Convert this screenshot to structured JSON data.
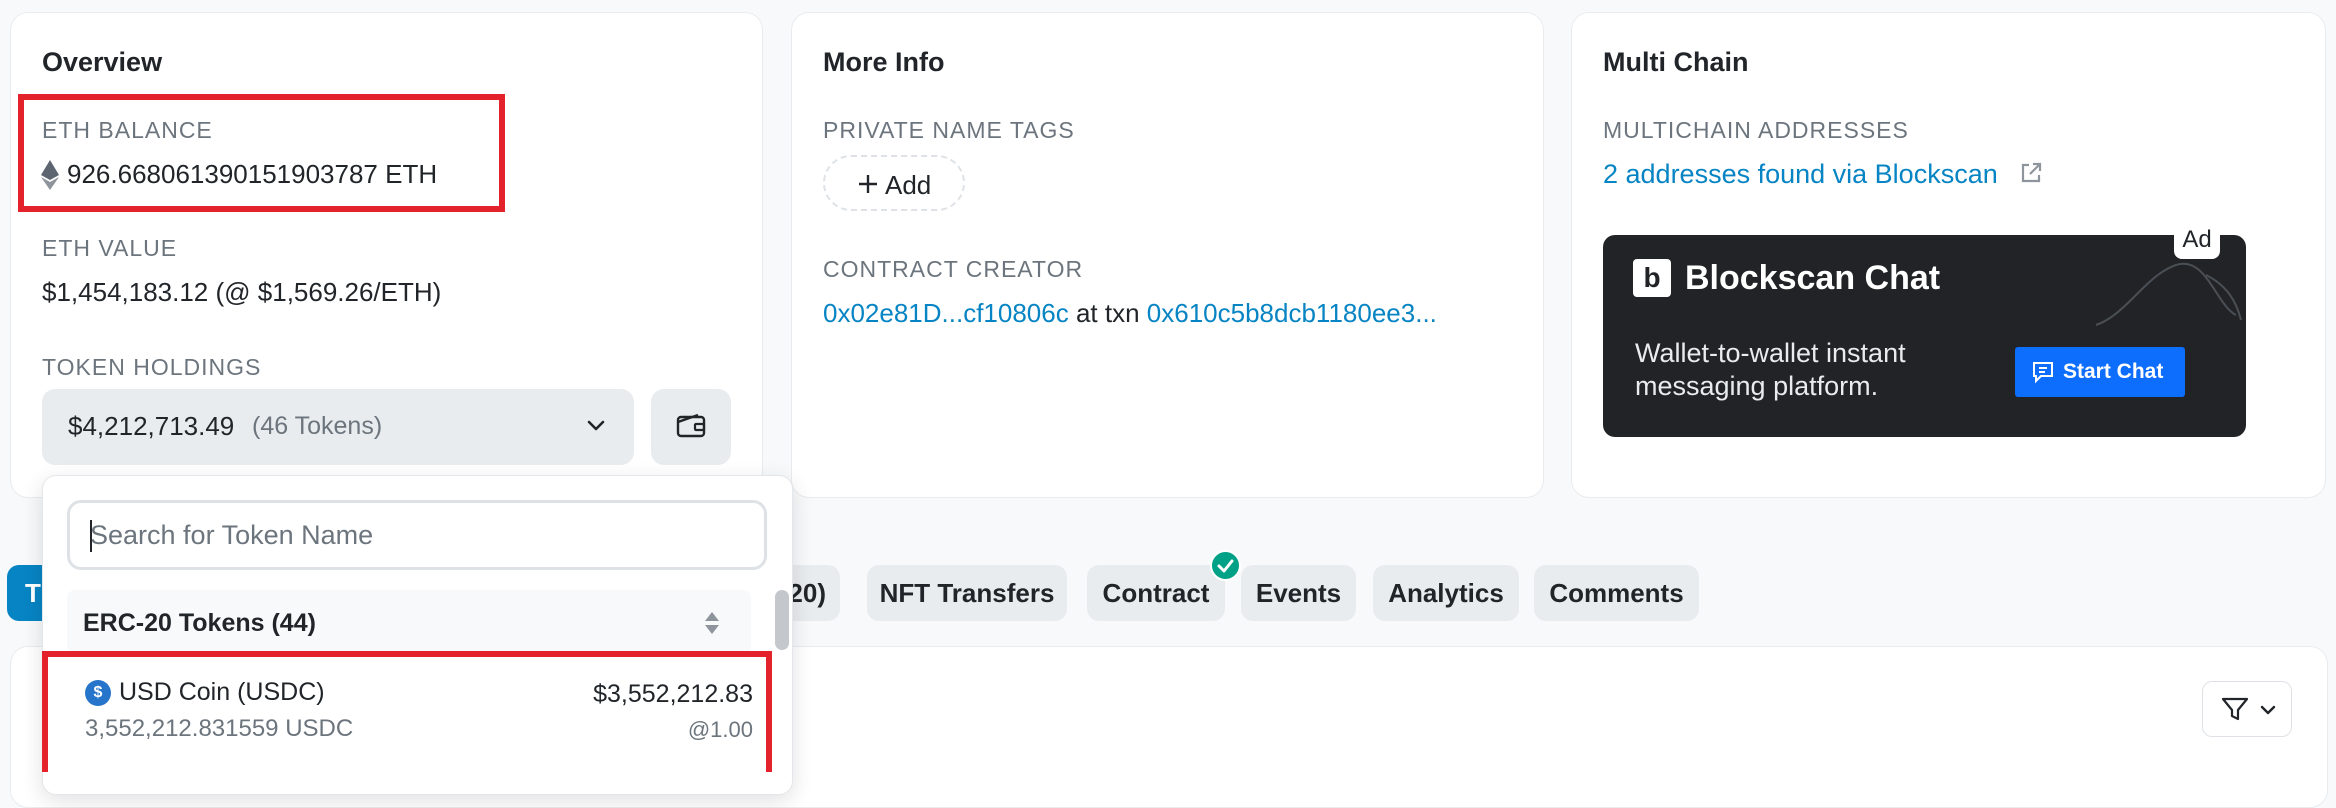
{
  "overview": {
    "title": "Overview",
    "eth_balance_label": "ETH BALANCE",
    "eth_balance_value": "926.668061390151903787 ETH",
    "eth_value_label": "ETH VALUE",
    "eth_value_value": "$1,454,183.12 (@ $1,569.26/ETH)",
    "token_holdings_label": "TOKEN HOLDINGS",
    "token_holdings_value": "$4,212,713.49",
    "token_holdings_count": "(46 Tokens)"
  },
  "more_info": {
    "title": "More Info",
    "private_tags_label": "PRIVATE NAME TAGS",
    "add_label": "Add",
    "contract_creator_label": "CONTRACT CREATOR",
    "creator_address": "0x02e81D...cf10806c",
    "at_txn_text": "at txn",
    "txn_hash": "0x610c5b8dcb1180ee3..."
  },
  "multi_chain": {
    "title": "Multi Chain",
    "addresses_label": "MULTICHAIN ADDRESSES",
    "addresses_link": "2 addresses found via Blockscan"
  },
  "ad": {
    "badge": "Ad",
    "brand": "Blockscan Chat",
    "line1": "Wallet-to-wallet instant",
    "line2": "messaging platform.",
    "cta": "Start Chat"
  },
  "tabs": [
    {
      "label": "T"
    },
    {
      "label": "20)"
    },
    {
      "label": "NFT Transfers"
    },
    {
      "label": "Contract"
    },
    {
      "label": "Events"
    },
    {
      "label": "Analytics"
    },
    {
      "label": "Comments"
    }
  ],
  "token_dropdown": {
    "search_placeholder": "Search for Token Name",
    "group_label": "ERC-20 Tokens (44)",
    "items": [
      {
        "name": "USD Coin (USDC)",
        "value": "$3,552,212.83",
        "amount": "3,552,212.831559 USDC",
        "rate": "@1.00"
      }
    ]
  },
  "colors": {
    "link": "#0784c3",
    "highlight_box": "#e3222c",
    "verified_badge": "#00a186",
    "ad_background": "#212326",
    "cta_button": "#0d6efd"
  },
  "icons": [
    "ethereum-icon",
    "chevron-down-icon",
    "wallet-icon",
    "plus-icon",
    "external-link-icon",
    "checkmark-icon",
    "filter-icon",
    "sort-icon",
    "usdc-icon",
    "chat-icon"
  ]
}
